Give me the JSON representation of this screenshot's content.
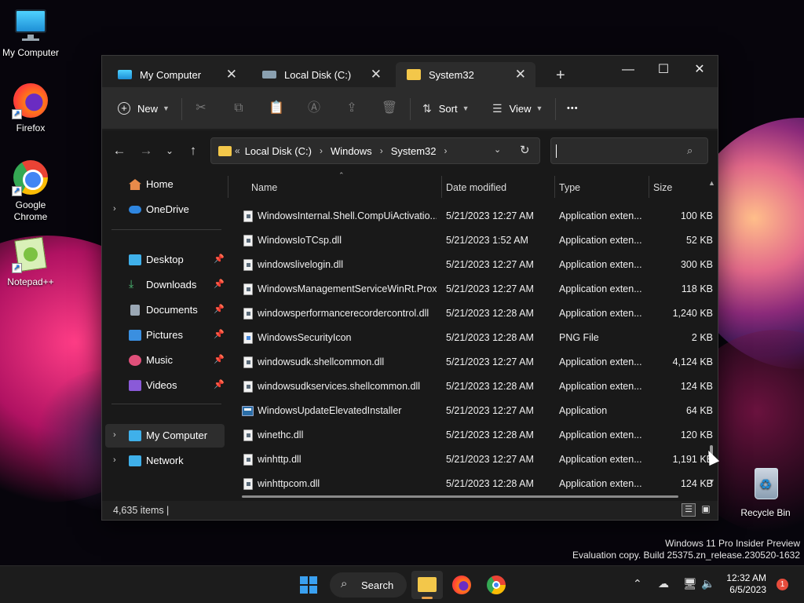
{
  "desktop": {
    "icons": [
      {
        "label": "My Computer"
      },
      {
        "label": "Firefox"
      },
      {
        "label": "Google Chrome"
      },
      {
        "label": "Notepad++"
      },
      {
        "label": "Recycle Bin"
      }
    ]
  },
  "window": {
    "tabs": [
      {
        "label": "My Computer",
        "close": "✕"
      },
      {
        "label": "Local Disk (C:)",
        "close": "✕"
      },
      {
        "label": "System32",
        "close": "✕"
      }
    ],
    "new_tab": "+",
    "controls": {
      "minimize": "—",
      "maximize": "☐",
      "close": "✕"
    },
    "toolbar": {
      "new_label": "New",
      "sort_label": "Sort",
      "view_label": "View",
      "more_label": "•••"
    },
    "address": {
      "overflow": "«",
      "crumbs": [
        "Local Disk (C:)",
        "Windows",
        "System32"
      ],
      "separator": "›"
    },
    "search": {
      "value": ""
    },
    "nav": {
      "items": [
        {
          "label": "Home"
        },
        {
          "label": "OneDrive"
        },
        {
          "label": "Desktop"
        },
        {
          "label": "Downloads"
        },
        {
          "label": "Documents"
        },
        {
          "label": "Pictures"
        },
        {
          "label": "Music"
        },
        {
          "label": "Videos"
        },
        {
          "label": "My Computer"
        },
        {
          "label": "Network"
        }
      ]
    },
    "columns": {
      "name": "Name",
      "date": "Date modified",
      "type": "Type",
      "size": "Size"
    },
    "files": [
      {
        "name": "WindowsInternal.Shell.CompUiActivatio...",
        "date": "5/21/2023 12:27 AM",
        "type": "Application exten...",
        "size": "100 KB",
        "kind": "dll"
      },
      {
        "name": "WindowsIoTCsp.dll",
        "date": "5/21/2023 1:52 AM",
        "type": "Application exten...",
        "size": "52 KB",
        "kind": "dll"
      },
      {
        "name": "windowslivelogin.dll",
        "date": "5/21/2023 12:27 AM",
        "type": "Application exten...",
        "size": "300 KB",
        "kind": "dll"
      },
      {
        "name": "WindowsManagementServiceWinRt.Prox...",
        "date": "5/21/2023 12:27 AM",
        "type": "Application exten...",
        "size": "118 KB",
        "kind": "dll"
      },
      {
        "name": "windowsperformancerecordercontrol.dll",
        "date": "5/21/2023 12:28 AM",
        "type": "Application exten...",
        "size": "1,240 KB",
        "kind": "dll"
      },
      {
        "name": "WindowsSecurityIcon",
        "date": "5/21/2023 12:28 AM",
        "type": "PNG File",
        "size": "2 KB",
        "kind": "png"
      },
      {
        "name": "windowsudk.shellcommon.dll",
        "date": "5/21/2023 12:27 AM",
        "type": "Application exten...",
        "size": "4,124 KB",
        "kind": "dll"
      },
      {
        "name": "windowsudkservices.shellcommon.dll",
        "date": "5/21/2023 12:28 AM",
        "type": "Application exten...",
        "size": "124 KB",
        "kind": "dll"
      },
      {
        "name": "WindowsUpdateElevatedInstaller",
        "date": "5/21/2023 12:27 AM",
        "type": "Application",
        "size": "64 KB",
        "kind": "app"
      },
      {
        "name": "winethc.dll",
        "date": "5/21/2023 12:28 AM",
        "type": "Application exten...",
        "size": "120 KB",
        "kind": "dll"
      },
      {
        "name": "winhttp.dll",
        "date": "5/21/2023 12:27 AM",
        "type": "Application exten...",
        "size": "1,191 KB",
        "kind": "dll"
      },
      {
        "name": "winhttpcom.dll",
        "date": "5/21/2023 12:28 AM",
        "type": "Application exten...",
        "size": "124 KB",
        "kind": "dll"
      }
    ],
    "status": {
      "count": "4,635 items",
      "divider": "|"
    }
  },
  "watermark": {
    "line1": "Windows 11 Pro Insider Preview",
    "line2": "Evaluation copy. Build 25375.zn_release.230520-1632"
  },
  "taskbar": {
    "search_label": "Search",
    "time": "12:32 AM",
    "date": "6/5/2023",
    "notification_count": "1"
  },
  "colors": {
    "window_bg": "#202020",
    "pane_bg": "#191919",
    "accent": "#3aa0f0",
    "folder": "#f3c74a"
  }
}
